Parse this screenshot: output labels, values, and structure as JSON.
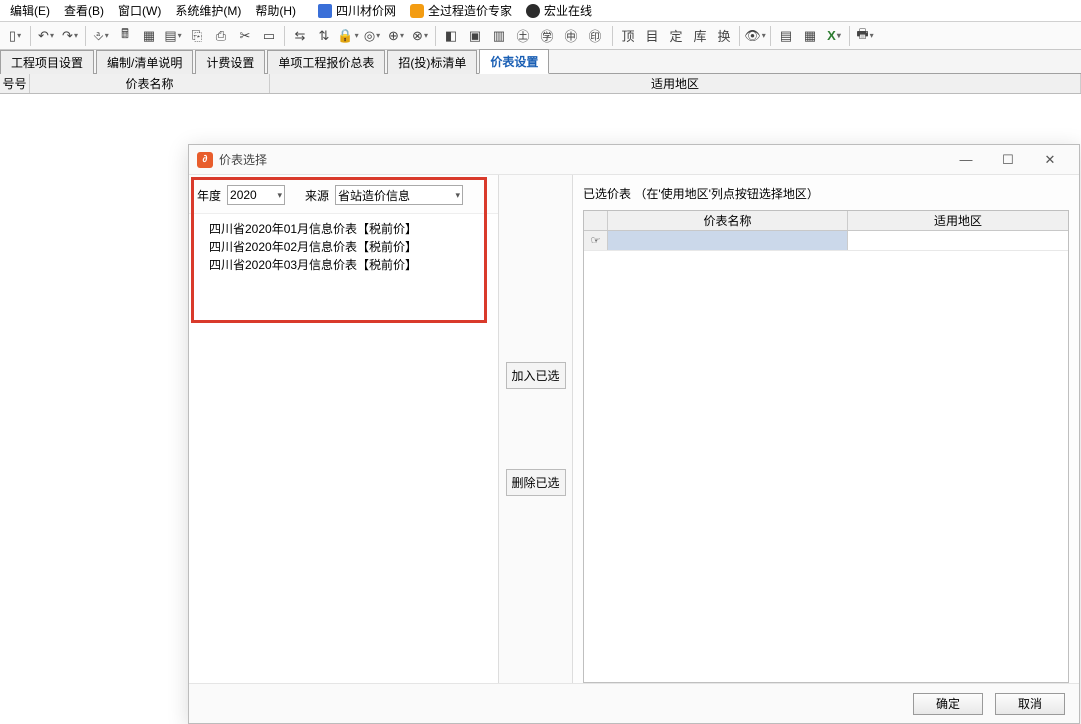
{
  "menu": {
    "edit": "编辑(E)",
    "view": "查看(B)",
    "window": "窗口(W)",
    "maintain": "系统维护(M)",
    "help": "帮助(H)",
    "ext1": "四川材价网",
    "ext2": "全过程造价专家",
    "ext3": "宏业在线"
  },
  "tabs": {
    "t1": "工程项目设置",
    "t2": "编制/清单说明",
    "t3": "计费设置",
    "t4": "单项工程报价总表",
    "t5": "招(投)标清单",
    "t6": "价表设置"
  },
  "grid": {
    "col1": "号号",
    "col2": "价表名称",
    "col3": "适用地区"
  },
  "dialog": {
    "title": "价表选择",
    "year_label": "年度",
    "year_value": "2020",
    "source_label": "来源",
    "source_value": "省站造价信息",
    "list_items": [
      "四川省2020年01月信息价表【税前价】",
      "四川省2020年02月信息价表【税前价】",
      "四川省2020年03月信息价表【税前价】"
    ],
    "add_btn": "加入已选",
    "remove_btn": "删除已选",
    "selected_title": "已选价表  （在'使用地区'列点按钮选择地区）",
    "sel_col1": "价表名称",
    "sel_col2": "适用地区",
    "pointer_icon": "☞",
    "ok": "确定",
    "cancel": "取消"
  }
}
